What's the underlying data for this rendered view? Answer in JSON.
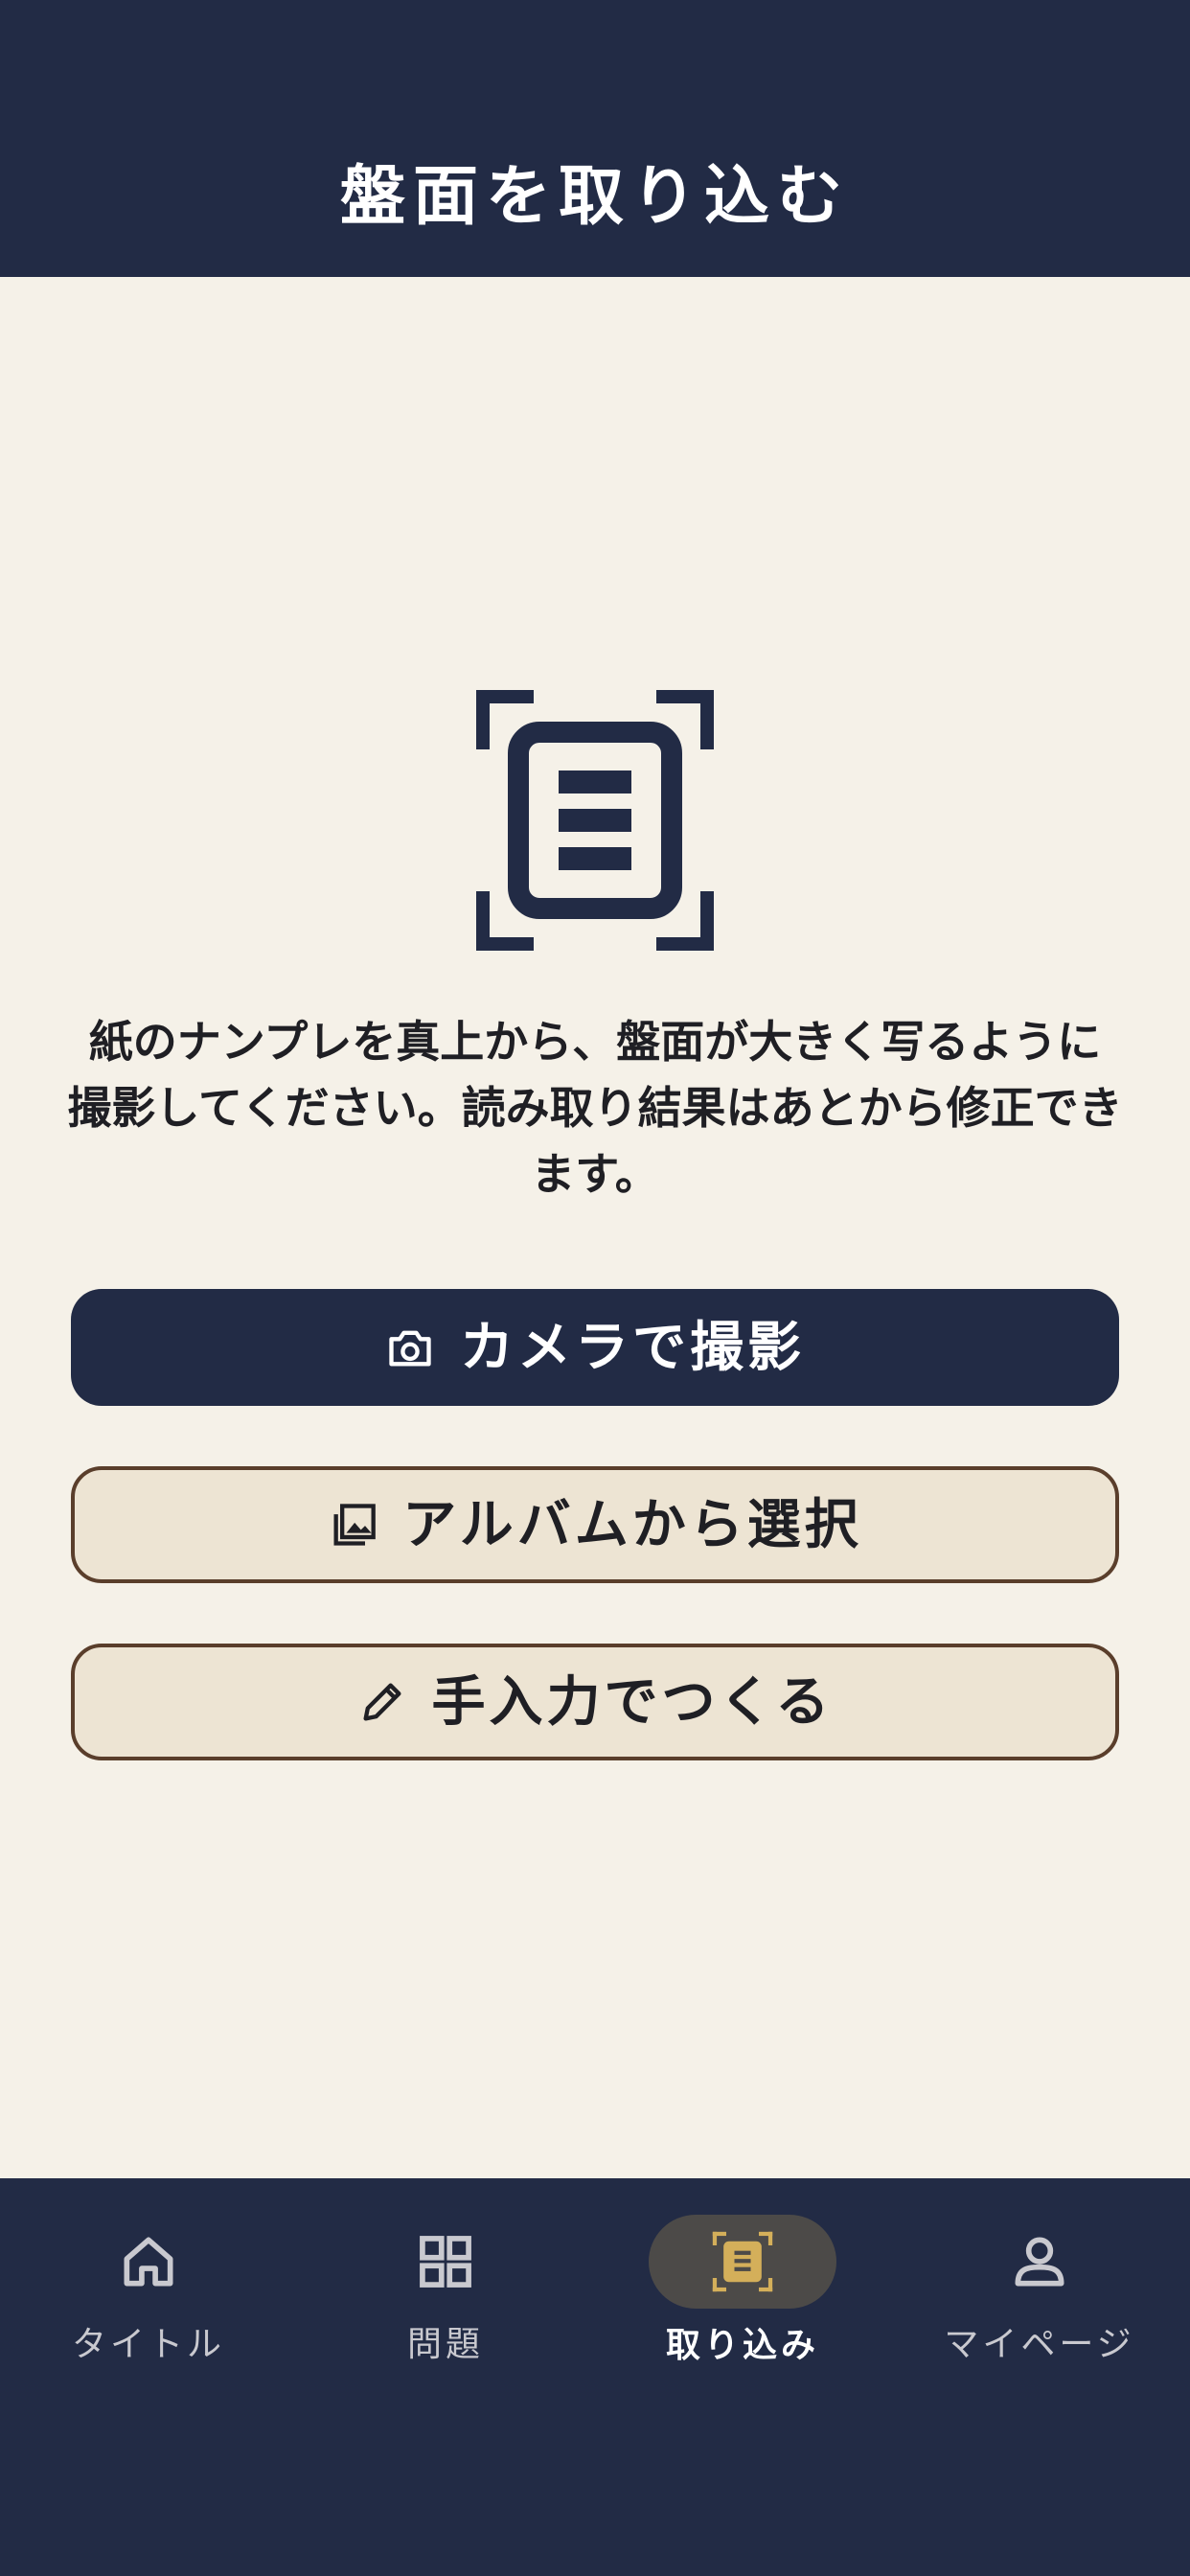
{
  "header": {
    "title": "盤面を取り込む"
  },
  "main": {
    "illustration_icon": "document-scan-icon",
    "instruction": "紙のナンプレを真上から、盤面が大きく写るように撮影してください。読み取り結果はあとから修正できます。",
    "buttons": [
      {
        "label": "カメラで撮影",
        "icon": "camera-icon"
      },
      {
        "label": "アルバムから選択",
        "icon": "photo-library-icon"
      },
      {
        "label": "手入力でつくる",
        "icon": "pencil-icon"
      }
    ]
  },
  "tabbar": {
    "active_index": 2,
    "items": [
      {
        "label": "タイトル",
        "icon": "home-icon"
      },
      {
        "label": "問題",
        "icon": "grid-icon"
      },
      {
        "label": "取り込み",
        "icon": "document-scan-icon"
      },
      {
        "label": "マイページ",
        "icon": "person-icon"
      }
    ]
  },
  "colors": {
    "navy": "#222B45",
    "background": "#F5F1E8",
    "secondary_button": "#EDE4D3",
    "secondary_border": "#5A3E2B",
    "accent_gold": "#D4AF5A",
    "active_pill": "#4C4A48"
  }
}
